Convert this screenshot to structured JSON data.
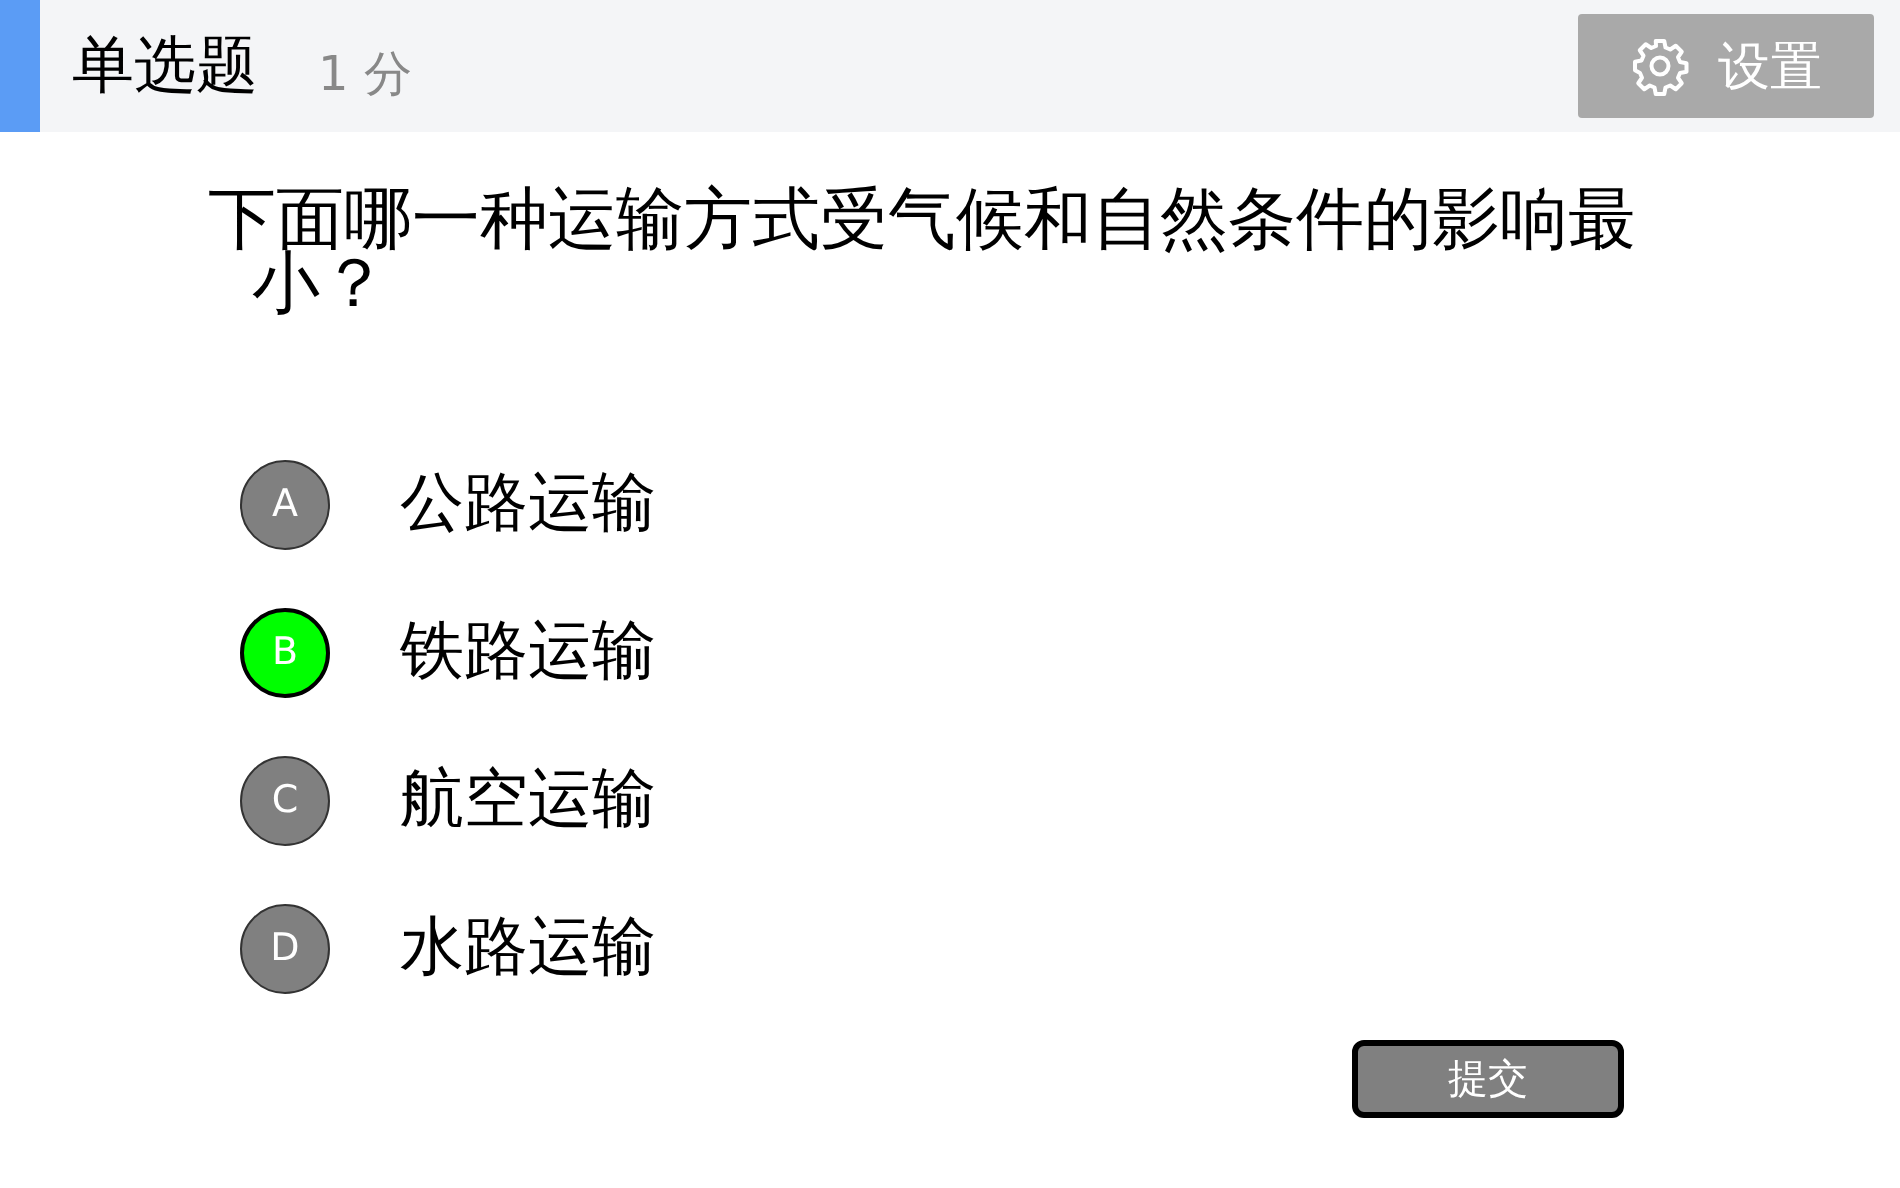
{
  "header": {
    "title": "单选题",
    "score": "1 分",
    "settings_button": "设置"
  },
  "question": "下面哪一种运输方式受气候和自然条件的影响最小？",
  "options": [
    {
      "letter": "A",
      "text": "公路运输",
      "selected": false
    },
    {
      "letter": "B",
      "text": "铁路运输",
      "selected": true
    },
    {
      "letter": "C",
      "text": "航空运输",
      "selected": false
    },
    {
      "letter": "D",
      "text": "水路运输",
      "selected": false
    }
  ],
  "submit_button": "提交"
}
